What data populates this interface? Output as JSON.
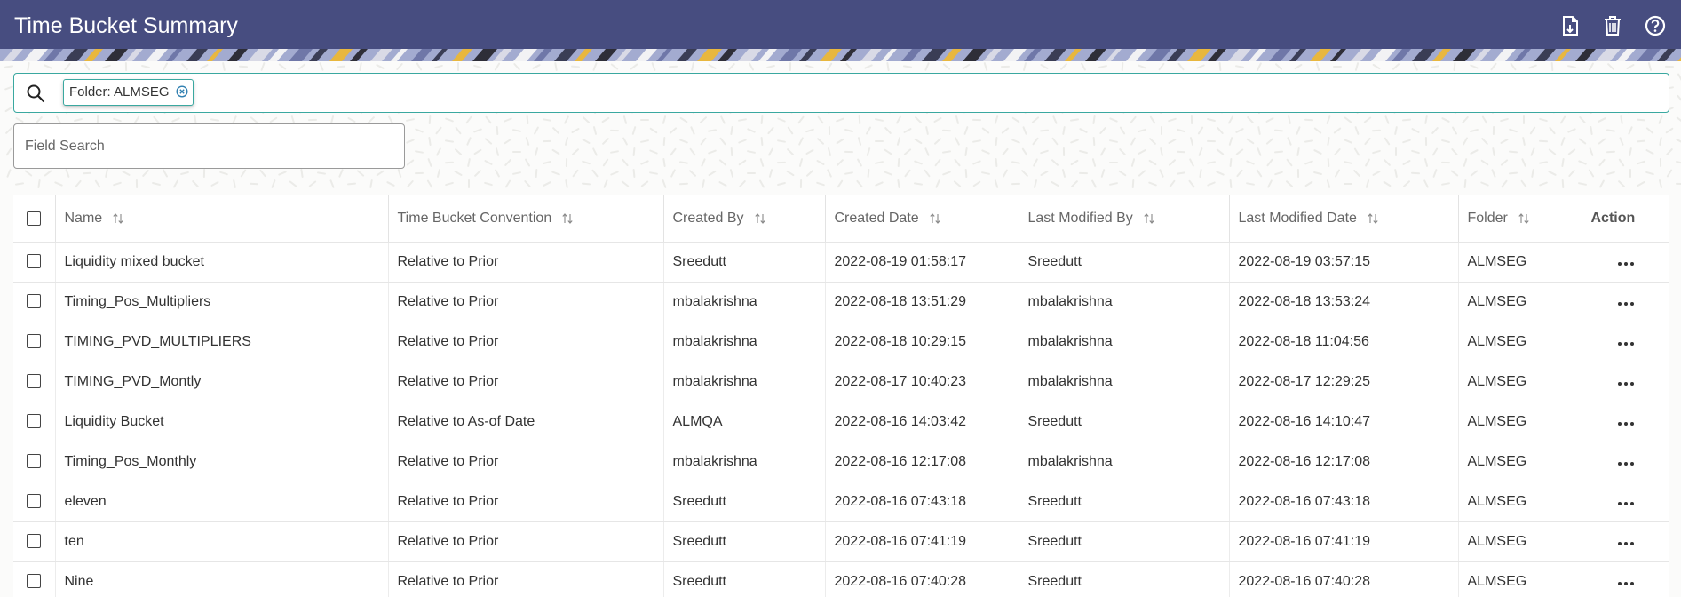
{
  "header": {
    "title": "Time Bucket Summary",
    "icons": [
      "add-document-icon",
      "delete-icon",
      "help-icon"
    ],
    "background_color": "#474d80"
  },
  "search": {
    "chip_label": "Folder: ALMSEG",
    "field_search_placeholder": "Field Search",
    "accent_color": "#3aa8a0"
  },
  "table": {
    "columns": [
      "Name",
      "Time Bucket Convention",
      "Created By",
      "Created Date",
      "Last Modified By",
      "Last Modified Date",
      "Folder",
      "Action"
    ],
    "rows": [
      {
        "name": "Liquidity mixed bucket",
        "convention": "Relative to Prior",
        "created_by": "Sreedutt",
        "created_date": "2022-08-19 01:58:17",
        "modified_by": "Sreedutt",
        "modified_date": "2022-08-19 03:57:15",
        "folder": "ALMSEG"
      },
      {
        "name": "Timing_Pos_Multipliers",
        "convention": "Relative to Prior",
        "created_by": "mbalakrishna",
        "created_date": "2022-08-18 13:51:29",
        "modified_by": "mbalakrishna",
        "modified_date": "2022-08-18 13:53:24",
        "folder": "ALMSEG"
      },
      {
        "name": "TIMING_PVD_MULTIPLIERS",
        "convention": "Relative to Prior",
        "created_by": "mbalakrishna",
        "created_date": "2022-08-18 10:29:15",
        "modified_by": "mbalakrishna",
        "modified_date": "2022-08-18 11:04:56",
        "folder": "ALMSEG"
      },
      {
        "name": "TIMING_PVD_Montly",
        "convention": "Relative to Prior",
        "created_by": "mbalakrishna",
        "created_date": "2022-08-17 10:40:23",
        "modified_by": "mbalakrishna",
        "modified_date": "2022-08-17 12:29:25",
        "folder": "ALMSEG"
      },
      {
        "name": "Liquidity Bucket",
        "convention": "Relative to As-of Date",
        "created_by": "ALMQA",
        "created_date": "2022-08-16 14:03:42",
        "modified_by": "Sreedutt",
        "modified_date": "2022-08-16 14:10:47",
        "folder": "ALMSEG"
      },
      {
        "name": "Timing_Pos_Monthly",
        "convention": "Relative to Prior",
        "created_by": "mbalakrishna",
        "created_date": "2022-08-16 12:17:08",
        "modified_by": "mbalakrishna",
        "modified_date": "2022-08-16 12:17:08",
        "folder": "ALMSEG"
      },
      {
        "name": "eleven",
        "convention": "Relative to Prior",
        "created_by": "Sreedutt",
        "created_date": "2022-08-16 07:43:18",
        "modified_by": "Sreedutt",
        "modified_date": "2022-08-16 07:43:18",
        "folder": "ALMSEG"
      },
      {
        "name": "ten",
        "convention": "Relative to Prior",
        "created_by": "Sreedutt",
        "created_date": "2022-08-16 07:41:19",
        "modified_by": "Sreedutt",
        "modified_date": "2022-08-16 07:41:19",
        "folder": "ALMSEG"
      },
      {
        "name": "Nine",
        "convention": "Relative to Prior",
        "created_by": "Sreedutt",
        "created_date": "2022-08-16 07:40:28",
        "modified_by": "Sreedutt",
        "modified_date": "2022-08-16 07:40:28",
        "folder": "ALMSEG"
      }
    ]
  }
}
